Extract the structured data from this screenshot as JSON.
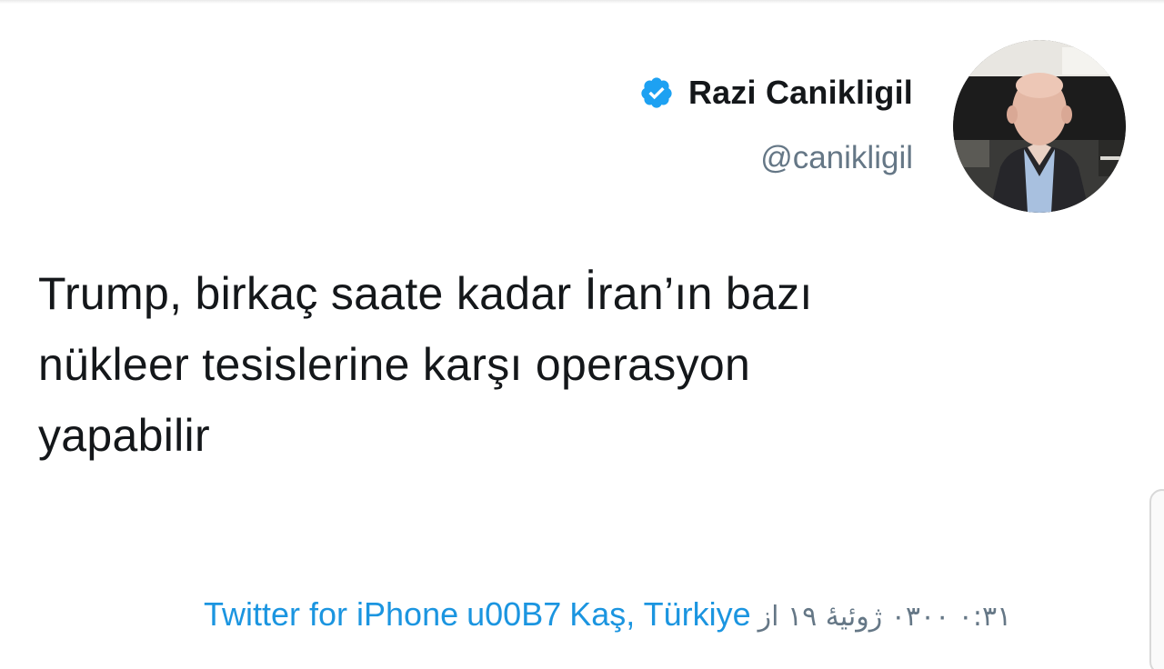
{
  "tweet": {
    "author": {
      "display_name": "Razi Canikligil",
      "handle": "@canikligil",
      "verified_icon": "verified-badge-icon",
      "avatar_icon": "profile-photo"
    },
    "text_lines": [
      "Trump, birkaç saate kadar İran’ın bazı",
      "nükleer tesislerine karşı operasyon",
      "yapabilir"
    ],
    "meta": {
      "source": "Twitter for iPhone",
      "separator": "u00B7",
      "location": "Kaş, Türkiye",
      "timestamp": "۰:۳۱ ۰۳۰۰ ژوئیهٔ ۱۹ از"
    },
    "colors": {
      "link": "#1b95e0",
      "muted": "#657786",
      "text": "#14171a",
      "verified": "#1da1f2"
    }
  }
}
